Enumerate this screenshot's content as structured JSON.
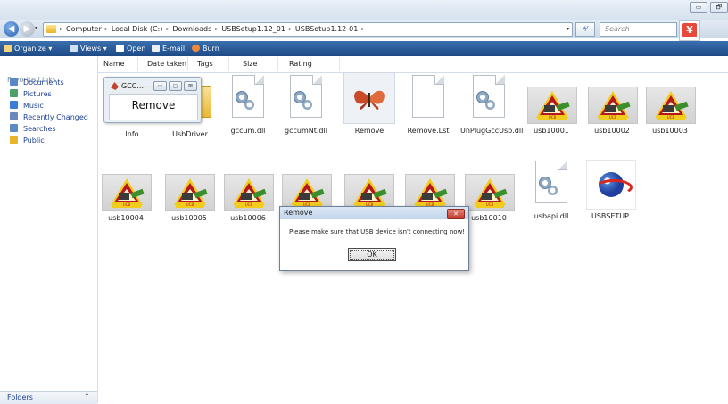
{
  "window": {
    "controls": {
      "minimize": "▭",
      "maximize": "🗗"
    }
  },
  "nav": {
    "back_glyph": "◀",
    "forward_glyph": "▶",
    "history_drop": "▾",
    "refresh_glyph": "⁴⁄",
    "breadcrumb": [
      "Computer",
      "Local Disk (C:)",
      "Downloads",
      "USBSetup1.12_01",
      "USBSetup1.12-01"
    ],
    "separator": "▸",
    "dropdown": "▾",
    "search_placeholder": "Search"
  },
  "toolbar": {
    "organize": "Organize ▾",
    "views": "Views ▾",
    "open": "Open",
    "email": "E-mail",
    "burn": "Burn"
  },
  "sidebar": {
    "title": "Favorite Links",
    "items": [
      {
        "label": "Documents",
        "icon": "documents-icon",
        "color": "#5a8ac6"
      },
      {
        "label": "Pictures",
        "icon": "pictures-icon",
        "color": "#4f9f68"
      },
      {
        "label": "Music",
        "icon": "music-icon",
        "color": "#3b7dd8"
      },
      {
        "label": "Recently Changed",
        "icon": "recent-icon",
        "color": "#6b88b8"
      },
      {
        "label": "Searches",
        "icon": "search-folder-icon",
        "color": "#5a8ac6"
      },
      {
        "label": "Public",
        "icon": "public-folder-icon",
        "color": "#e8b429"
      }
    ],
    "folders_label": "Folders",
    "folders_chevron": "⌃"
  },
  "columns": [
    "Name",
    "Date taken",
    "Tags",
    "Size",
    "Rating"
  ],
  "files_row1": [
    {
      "label": "Info",
      "icon": "folder-icon"
    },
    {
      "label": "UsbDriver",
      "icon": "folder-icon"
    },
    {
      "label": "gccum.dll",
      "icon": "dll-gear-icon"
    },
    {
      "label": "gccumNt.dll",
      "icon": "dll-gear-icon"
    },
    {
      "label": "Remove",
      "icon": "butterfly-app-icon"
    },
    {
      "label": "Remove.Lst",
      "icon": "blank-file-icon"
    },
    {
      "label": "UnPlugGccUsb.dll",
      "icon": "dll-gear-icon"
    },
    {
      "label": "usb10001",
      "icon": "usb-warning-icon"
    },
    {
      "label": "usb10002",
      "icon": "usb-warning-icon"
    },
    {
      "label": "usb10003",
      "icon": "usb-warning-icon"
    }
  ],
  "files_row2": [
    {
      "label": "usb10004",
      "icon": "usb-warning-icon"
    },
    {
      "label": "usb10005",
      "icon": "usb-warning-icon"
    },
    {
      "label": "usb10006",
      "icon": "usb-warning-icon"
    },
    {
      "label": "",
      "icon": "usb-warning-icon"
    },
    {
      "label": "",
      "icon": "usb-warning-icon"
    },
    {
      "label": "",
      "icon": "usb-warning-icon"
    },
    {
      "label": "usb10010",
      "icon": "usb-warning-icon"
    },
    {
      "label": "usbapi.dll",
      "icon": "dll-gear-icon"
    },
    {
      "label": "USBSETUP",
      "icon": "setup-globe-icon"
    }
  ],
  "usb_badge": "UCB",
  "mini_window": {
    "title": "GCC...",
    "controls": [
      "▭",
      "▢",
      "⊠"
    ],
    "body": "Remove"
  },
  "dialog": {
    "title": "Remove",
    "close": "✕",
    "message": "Please make sure that USB device isn't connecting now!",
    "ok": "OK"
  },
  "app_icon_glyph": "¥"
}
